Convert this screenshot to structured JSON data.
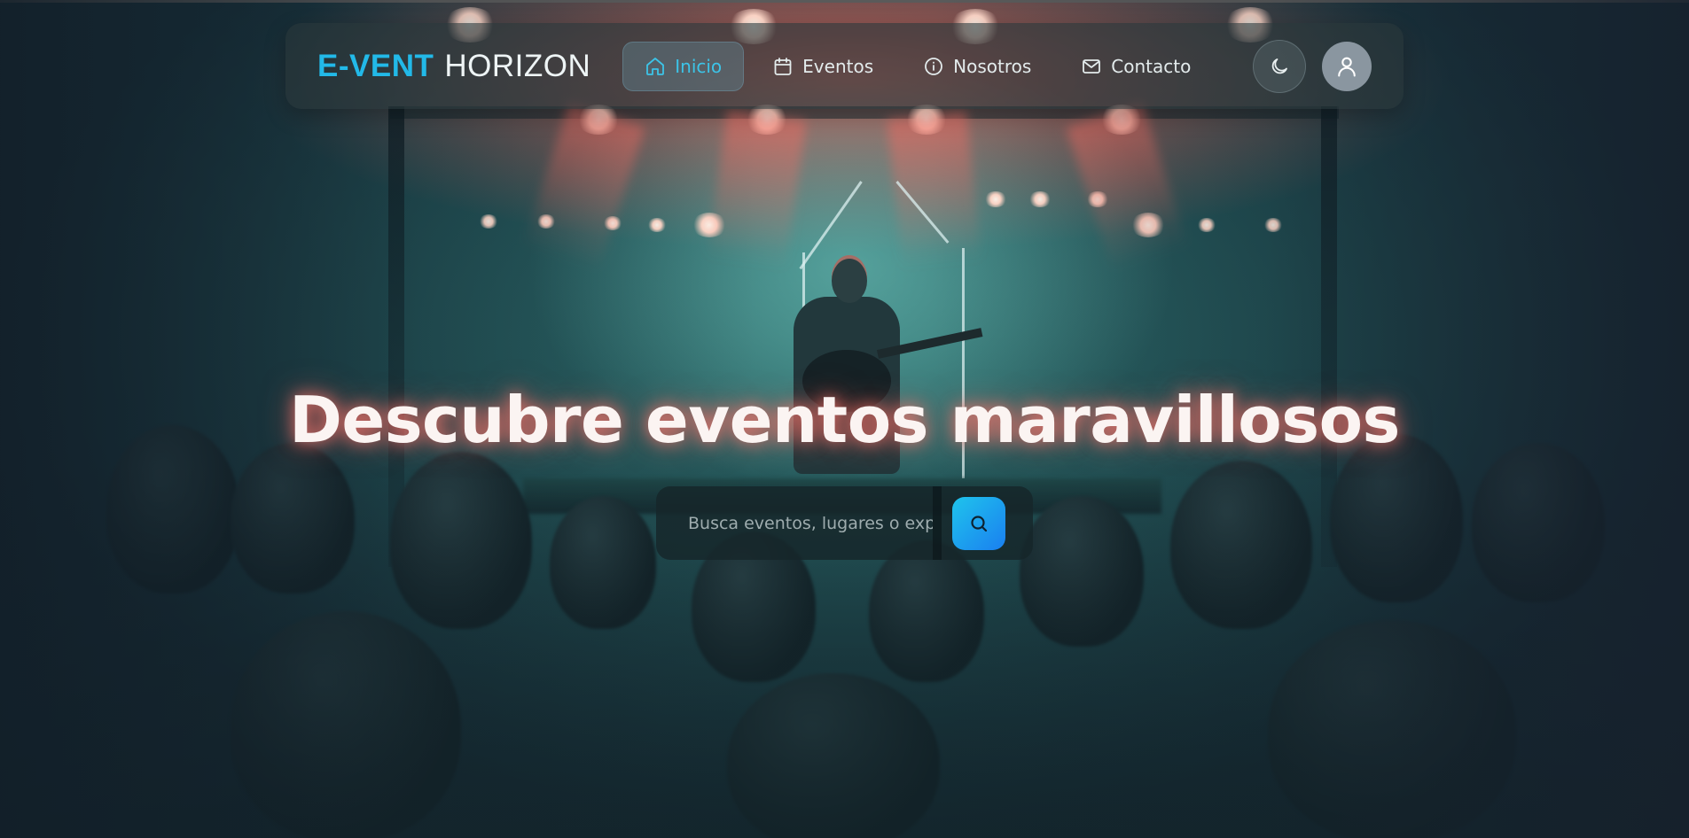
{
  "brand": {
    "accent": "E-VENT",
    "rest": "HORIZON"
  },
  "nav": {
    "items": [
      {
        "label": "Inicio",
        "icon": "home-icon",
        "active": true
      },
      {
        "label": "Eventos",
        "icon": "calendar-icon",
        "active": false
      },
      {
        "label": "Nosotros",
        "icon": "info-icon",
        "active": false
      },
      {
        "label": "Contacto",
        "icon": "mail-icon",
        "active": false
      }
    ],
    "theme_toggle_icon": "moon-icon",
    "user_icon": "user-icon"
  },
  "hero": {
    "title": "Descubre eventos maravillosos",
    "background": "concert-stage-photo"
  },
  "search": {
    "placeholder": "Busca eventos, lugares o experiencias",
    "button_icon": "search-icon"
  },
  "colors": {
    "accent": "#22b9e8",
    "nav_active_text": "#3cc4e8",
    "search_button_start": "#1fc4ec",
    "search_button_end": "#1a7ff0",
    "title_glow": "#ff7a6e"
  }
}
